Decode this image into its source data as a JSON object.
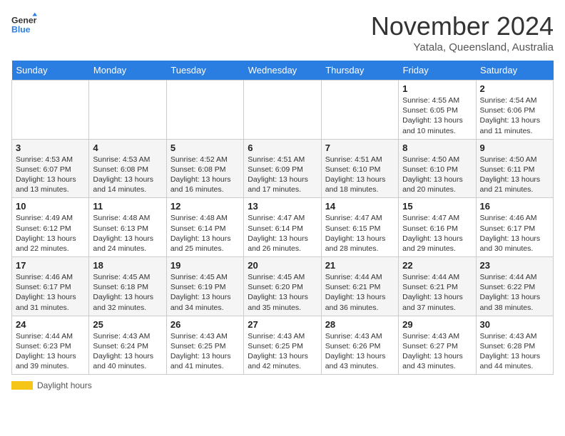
{
  "logo": {
    "line1": "General",
    "line2": "Blue"
  },
  "title": "November 2024",
  "location": "Yatala, Queensland, Australia",
  "days_of_week": [
    "Sunday",
    "Monday",
    "Tuesday",
    "Wednesday",
    "Thursday",
    "Friday",
    "Saturday"
  ],
  "weeks": [
    [
      {
        "num": "",
        "info": ""
      },
      {
        "num": "",
        "info": ""
      },
      {
        "num": "",
        "info": ""
      },
      {
        "num": "",
        "info": ""
      },
      {
        "num": "",
        "info": ""
      },
      {
        "num": "1",
        "info": "Sunrise: 4:55 AM\nSunset: 6:05 PM\nDaylight: 13 hours and 10 minutes."
      },
      {
        "num": "2",
        "info": "Sunrise: 4:54 AM\nSunset: 6:06 PM\nDaylight: 13 hours and 11 minutes."
      }
    ],
    [
      {
        "num": "3",
        "info": "Sunrise: 4:53 AM\nSunset: 6:07 PM\nDaylight: 13 hours and 13 minutes."
      },
      {
        "num": "4",
        "info": "Sunrise: 4:53 AM\nSunset: 6:08 PM\nDaylight: 13 hours and 14 minutes."
      },
      {
        "num": "5",
        "info": "Sunrise: 4:52 AM\nSunset: 6:08 PM\nDaylight: 13 hours and 16 minutes."
      },
      {
        "num": "6",
        "info": "Sunrise: 4:51 AM\nSunset: 6:09 PM\nDaylight: 13 hours and 17 minutes."
      },
      {
        "num": "7",
        "info": "Sunrise: 4:51 AM\nSunset: 6:10 PM\nDaylight: 13 hours and 18 minutes."
      },
      {
        "num": "8",
        "info": "Sunrise: 4:50 AM\nSunset: 6:10 PM\nDaylight: 13 hours and 20 minutes."
      },
      {
        "num": "9",
        "info": "Sunrise: 4:50 AM\nSunset: 6:11 PM\nDaylight: 13 hours and 21 minutes."
      }
    ],
    [
      {
        "num": "10",
        "info": "Sunrise: 4:49 AM\nSunset: 6:12 PM\nDaylight: 13 hours and 22 minutes."
      },
      {
        "num": "11",
        "info": "Sunrise: 4:48 AM\nSunset: 6:13 PM\nDaylight: 13 hours and 24 minutes."
      },
      {
        "num": "12",
        "info": "Sunrise: 4:48 AM\nSunset: 6:14 PM\nDaylight: 13 hours and 25 minutes."
      },
      {
        "num": "13",
        "info": "Sunrise: 4:47 AM\nSunset: 6:14 PM\nDaylight: 13 hours and 26 minutes."
      },
      {
        "num": "14",
        "info": "Sunrise: 4:47 AM\nSunset: 6:15 PM\nDaylight: 13 hours and 28 minutes."
      },
      {
        "num": "15",
        "info": "Sunrise: 4:47 AM\nSunset: 6:16 PM\nDaylight: 13 hours and 29 minutes."
      },
      {
        "num": "16",
        "info": "Sunrise: 4:46 AM\nSunset: 6:17 PM\nDaylight: 13 hours and 30 minutes."
      }
    ],
    [
      {
        "num": "17",
        "info": "Sunrise: 4:46 AM\nSunset: 6:17 PM\nDaylight: 13 hours and 31 minutes."
      },
      {
        "num": "18",
        "info": "Sunrise: 4:45 AM\nSunset: 6:18 PM\nDaylight: 13 hours and 32 minutes."
      },
      {
        "num": "19",
        "info": "Sunrise: 4:45 AM\nSunset: 6:19 PM\nDaylight: 13 hours and 34 minutes."
      },
      {
        "num": "20",
        "info": "Sunrise: 4:45 AM\nSunset: 6:20 PM\nDaylight: 13 hours and 35 minutes."
      },
      {
        "num": "21",
        "info": "Sunrise: 4:44 AM\nSunset: 6:21 PM\nDaylight: 13 hours and 36 minutes."
      },
      {
        "num": "22",
        "info": "Sunrise: 4:44 AM\nSunset: 6:21 PM\nDaylight: 13 hours and 37 minutes."
      },
      {
        "num": "23",
        "info": "Sunrise: 4:44 AM\nSunset: 6:22 PM\nDaylight: 13 hours and 38 minutes."
      }
    ],
    [
      {
        "num": "24",
        "info": "Sunrise: 4:44 AM\nSunset: 6:23 PM\nDaylight: 13 hours and 39 minutes."
      },
      {
        "num": "25",
        "info": "Sunrise: 4:43 AM\nSunset: 6:24 PM\nDaylight: 13 hours and 40 minutes."
      },
      {
        "num": "26",
        "info": "Sunrise: 4:43 AM\nSunset: 6:25 PM\nDaylight: 13 hours and 41 minutes."
      },
      {
        "num": "27",
        "info": "Sunrise: 4:43 AM\nSunset: 6:25 PM\nDaylight: 13 hours and 42 minutes."
      },
      {
        "num": "28",
        "info": "Sunrise: 4:43 AM\nSunset: 6:26 PM\nDaylight: 13 hours and 43 minutes."
      },
      {
        "num": "29",
        "info": "Sunrise: 4:43 AM\nSunset: 6:27 PM\nDaylight: 13 hours and 43 minutes."
      },
      {
        "num": "30",
        "info": "Sunrise: 4:43 AM\nSunset: 6:28 PM\nDaylight: 13 hours and 44 minutes."
      }
    ]
  ],
  "footer": {
    "daylight_label": "Daylight hours"
  }
}
